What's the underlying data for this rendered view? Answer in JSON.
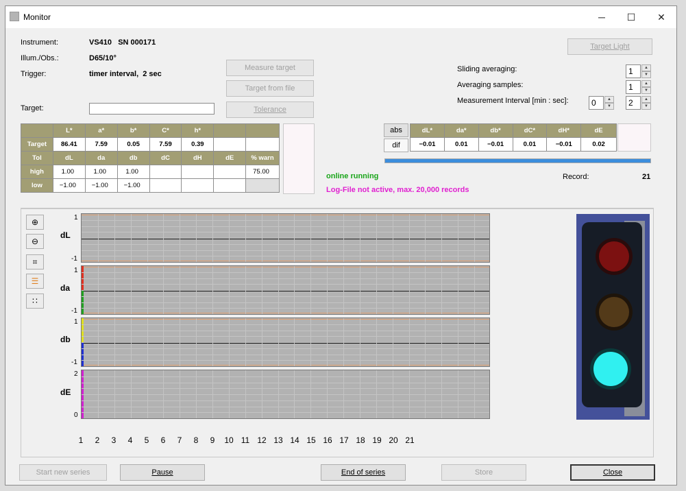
{
  "window": {
    "title": "Monitor",
    "min": "─",
    "max": "☐",
    "close": "✕"
  },
  "info": {
    "instrument_label": "Instrument:",
    "instrument_value": "VS410   SN 000171",
    "illum_label": "Illum./Obs.:",
    "illum_value": "D65/10°",
    "trigger_label": "Trigger:",
    "trigger_value": "timer interval,  2 sec",
    "target_label": "Target:",
    "target_value": ""
  },
  "buttons": {
    "measure_target": "Measure target",
    "target_from_file": "Target from file",
    "tolerance": "Tolerance",
    "target_light": "Target Light",
    "abs": "abs",
    "dif": "dif",
    "start_new_series": "Start new series",
    "pause": "Pause",
    "end_of_series": "End of series",
    "store": "Store",
    "close": "Close"
  },
  "settings": {
    "sliding_label": "Sliding averaging:",
    "sliding_value": "1",
    "avg_label": "Averaging samples:",
    "avg_value": "1",
    "interval_label": "Measurement Interval [min : sec]:",
    "interval_min": "0",
    "interval_sec": "2"
  },
  "target_table": {
    "headers": [
      "",
      "L*",
      "a*",
      "b*",
      "C*",
      "h*",
      "",
      ""
    ],
    "target_row": [
      "Target",
      "86.41",
      "7.59",
      "0.05",
      "7.59",
      "0.39",
      "",
      ""
    ],
    "tol_header": [
      "Tol",
      "dL",
      "da",
      "db",
      "dC",
      "dH",
      "dE",
      "% warn"
    ],
    "high_row": [
      "high",
      "1.00",
      "1.00",
      "1.00",
      "",
      "",
      "",
      "75.00"
    ],
    "low_row": [
      "low",
      "−1.00",
      "−1.00",
      "−1.00",
      "",
      "",
      "",
      ""
    ]
  },
  "diff_table": {
    "headers": [
      "dL*",
      "da*",
      "db*",
      "dC*",
      "dH*",
      "dE"
    ],
    "values": [
      "−0.01",
      "0.01",
      "−0.01",
      "0.01",
      "−0.01",
      "0.02"
    ]
  },
  "status": {
    "online": "online running",
    "online_color": "#1aa51a",
    "logfile": "Log-File not active, max. 20,000 records",
    "logfile_color": "#e020d0",
    "record_label": "Record:",
    "record_value": "21"
  },
  "plots": {
    "dL": {
      "title": "dL",
      "ymax": "1",
      "ymin": "-1",
      "limit_color": "#e0a070"
    },
    "da": {
      "title": "da",
      "ymax": "1",
      "ymin": "-1",
      "accent_top": "#e03020",
      "accent_bottom": "#20a020"
    },
    "db": {
      "title": "db",
      "ymax": "1",
      "ymin": "-1",
      "accent_top": "#e0e020",
      "accent_bottom": "#2030d0"
    },
    "dE": {
      "title": "dE",
      "ymax": "2",
      "ymin": "0",
      "accent": "#d020d0"
    },
    "x_ticks": [
      "1",
      "2",
      "3",
      "4",
      "5",
      "6",
      "7",
      "8",
      "9",
      "10",
      "11",
      "12",
      "13",
      "14",
      "15",
      "16",
      "17",
      "18",
      "19",
      "20",
      "21"
    ]
  },
  "chart_data": {
    "type": "line",
    "x": [
      1,
      2,
      3,
      4,
      5,
      6,
      7,
      8,
      9,
      10,
      11,
      12,
      13,
      14,
      15,
      16,
      17,
      18,
      19,
      20,
      21
    ],
    "series": [
      {
        "name": "dL",
        "ylim": [
          -1,
          1
        ]
      },
      {
        "name": "da",
        "ylim": [
          -1,
          1
        ]
      },
      {
        "name": "db",
        "ylim": [
          -1,
          1
        ]
      },
      {
        "name": "dE",
        "ylim": [
          0,
          2
        ]
      }
    ]
  },
  "tools": [
    "zoom-in-icon",
    "zoom-out-icon",
    "crop-icon",
    "lines-icon",
    "dots-icon"
  ],
  "traffic_light": {
    "active": "green",
    "red": "#c01818",
    "yellow": "#6a4a20",
    "green": "#30f0f0"
  }
}
